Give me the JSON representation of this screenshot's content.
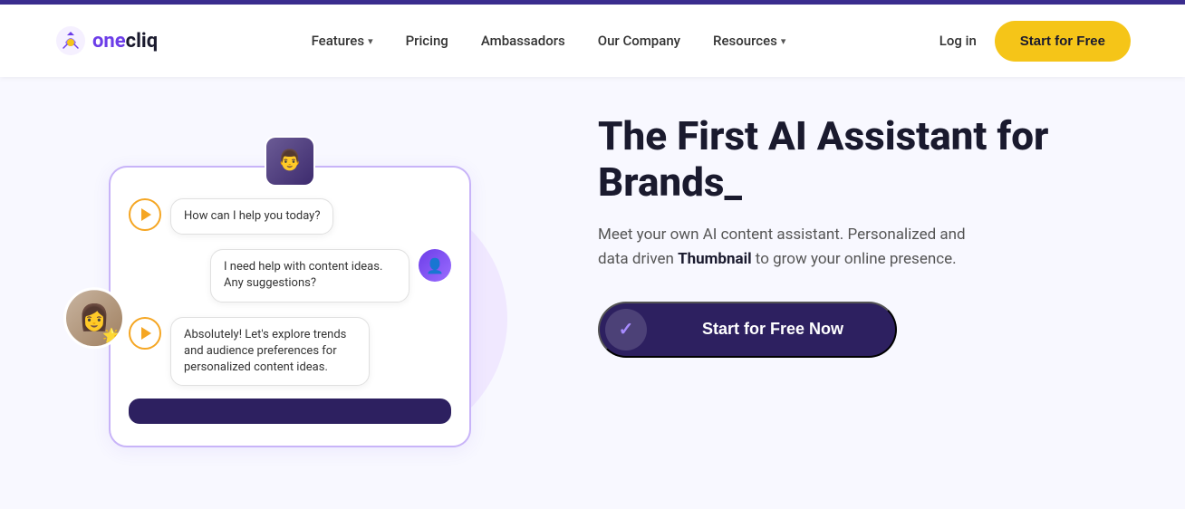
{
  "topbar": {},
  "nav": {
    "logo_text": "onecliq",
    "logo_icon": "✦",
    "links": [
      {
        "label": "Features",
        "has_dropdown": true
      },
      {
        "label": "Pricing",
        "has_dropdown": false
      },
      {
        "label": "Ambassadors",
        "has_dropdown": false
      },
      {
        "label": "Our Company",
        "has_dropdown": false
      },
      {
        "label": "Resources",
        "has_dropdown": true
      }
    ],
    "login_label": "Log in",
    "cta_label": "Start for Free"
  },
  "hero": {
    "title_line1": "The First AI Assistant for",
    "title_line2": "Brands_",
    "description_part1": "Meet your own AI content assistant. Personalized and data driven ",
    "description_bold": "Thumbnail",
    "description_part2": " to grow your online presence.",
    "cta_label": "Start for Free Now"
  },
  "chat": {
    "messages": [
      {
        "type": "left",
        "text": "How can I help you today?",
        "has_play": true
      },
      {
        "type": "right",
        "text": "I need help with content ideas. Any suggestions?",
        "has_avatar": true
      },
      {
        "type": "left",
        "text": "Absolutely! Let's explore trends and audience preferences for personalized content ideas.",
        "has_play": true
      }
    ]
  }
}
